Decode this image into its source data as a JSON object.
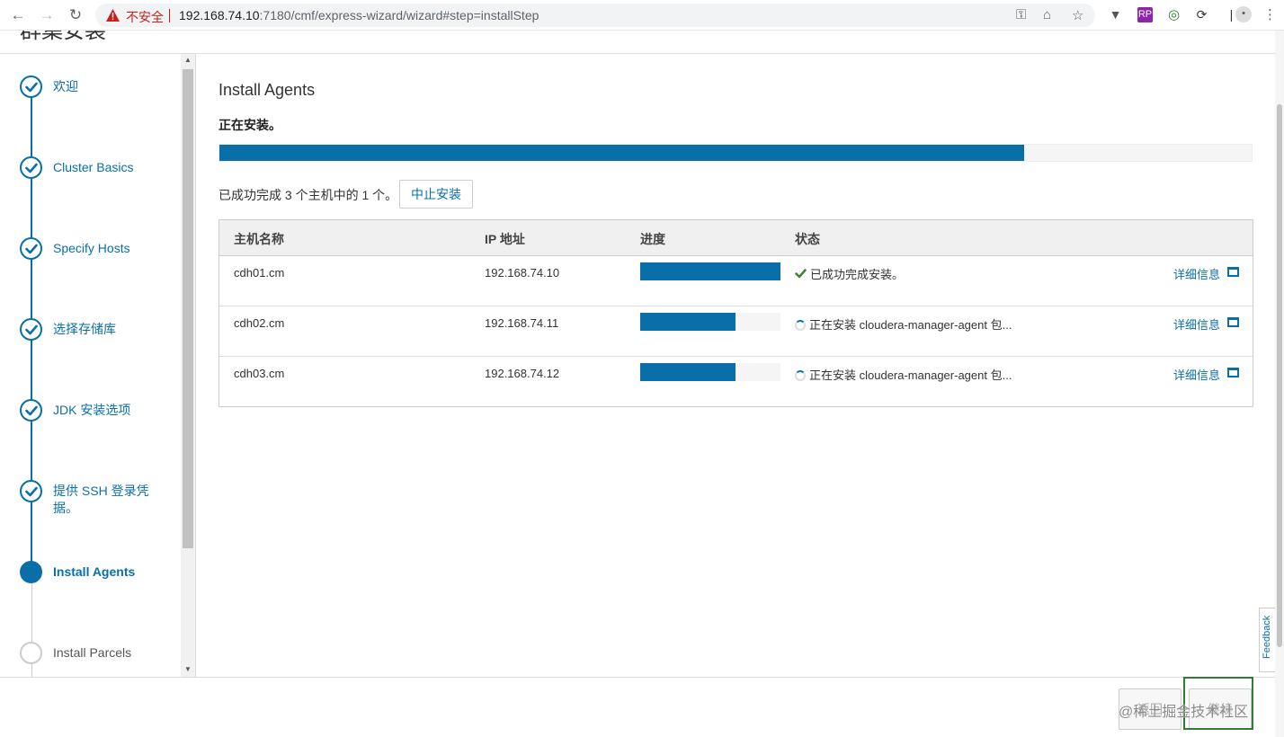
{
  "browser": {
    "security_label": "不安全",
    "url_host": "192.168.74.10",
    "url_rest": ":7180/cmf/express-wizard/wizard#step=installStep",
    "extension_rp_label": "RP"
  },
  "page": {
    "title": "群集安装"
  },
  "sidebar": {
    "steps": [
      {
        "label": "欢迎",
        "state": "done"
      },
      {
        "label": "Cluster Basics",
        "state": "done"
      },
      {
        "label": "Specify Hosts",
        "state": "done"
      },
      {
        "label": "选择存储库",
        "state": "done"
      },
      {
        "label": "JDK 安装选项",
        "state": "done"
      },
      {
        "label": "提供 SSH 登录凭据。",
        "state": "done"
      },
      {
        "label": "Install Agents",
        "state": "active"
      },
      {
        "label": "Install Parcels",
        "state": "todo"
      }
    ]
  },
  "main": {
    "title": "Install Agents",
    "status": "正在安装。",
    "overall_progress": 0.78,
    "summary": "已成功完成 3 个主机中的 1 个。",
    "abort_label": "中止安装",
    "columns": [
      "主机名称",
      "IP 地址",
      "进度",
      "状态"
    ],
    "rows": [
      {
        "host": "cdh01.cm",
        "ip": "192.168.74.10",
        "progress": 1.0,
        "status": "已成功完成安装。",
        "done": true,
        "detail": "详细信息"
      },
      {
        "host": "cdh02.cm",
        "ip": "192.168.74.11",
        "progress": 0.68,
        "status": "正在安装 cloudera-manager-agent 包...",
        "done": false,
        "detail": "详细信息"
      },
      {
        "host": "cdh03.cm",
        "ip": "192.168.74.12",
        "progress": 0.68,
        "status": "正在安装 cloudera-manager-agent 包...",
        "done": false,
        "detail": "详细信息"
      }
    ]
  },
  "feedback_label": "Feedback",
  "footer": {
    "back_label": "返回",
    "next_label": "继续",
    "watermark": "@稀土掘金技术社区"
  },
  "colors": {
    "accent": "#0a6fa8",
    "success": "#3c8a2e",
    "highlight": "#2e7d32",
    "warning": "#c5221f"
  }
}
